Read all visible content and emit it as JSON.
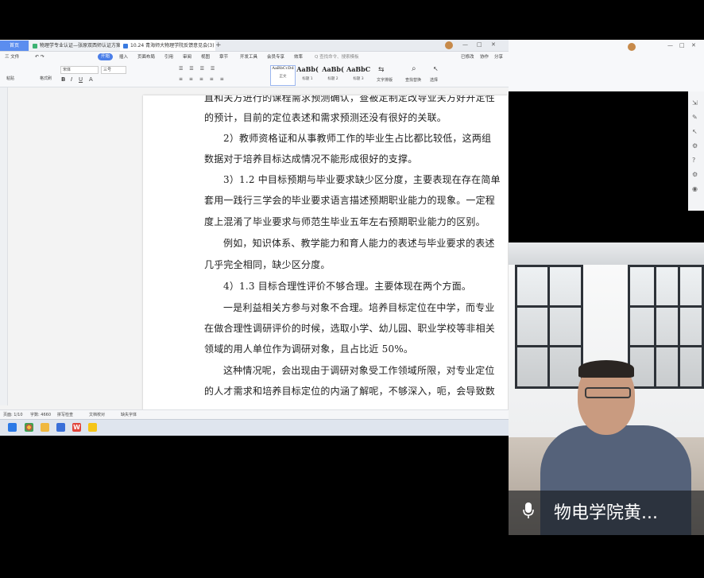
{
  "tabs": {
    "home": "首页",
    "tab1": "物理学专业认证—张原双西师认证方案",
    "tab2": "10.24 青海师大物理学院反馈意见会(3)"
  },
  "menu": {
    "file": "三 文件",
    "items": [
      "开始",
      "插入",
      "页面布局",
      "引用",
      "审阅",
      "视图",
      "章节",
      "开发工具",
      "会员专享",
      "效率"
    ],
    "search": "Q 查找命令、搜索模板",
    "right": [
      "已修改",
      "协作",
      "分享"
    ]
  },
  "ribbon": {
    "font_name": "宋体",
    "font_size": "三号",
    "paste": "粘贴",
    "format_painter": "格式刷",
    "styles": [
      {
        "sample": "AaBbCcDd",
        "label": "正文"
      },
      {
        "sample": "AaBb(",
        "label": "标题 1"
      },
      {
        "sample": "AaBb(",
        "label": "标题 2"
      },
      {
        "sample": "AaBbC",
        "label": "标题 3"
      }
    ],
    "text_layout": "文字排版",
    "find_replace": "查找替换",
    "select": "选择"
  },
  "document": {
    "lines": [
      "直和关方进行的课程需求预测确认，查被定制定改导业关方好开定性",
      "的预计，目前的定位表述和需求预测还没有很好的关联。",
      "2）教师资格证和从事教师工作的毕业生占比都比较低，这两组",
      "数据对于培养目标达成情况不能形成很好的支撑。",
      "3）1.2 中目标预期与毕业要求缺少区分度，主要表现在存在简单",
      "套用一践行三学会的毕业要求语言描述预期职业能力的现象。一定程",
      "度上混淆了毕业要求与师范生毕业五年左右预期职业能力的区别。",
      "例如，知识体系、教学能力和育人能力的表述与毕业要求的表述",
      "几乎完全相同，缺少区分度。",
      "4）1.3 目标合理性评价不够合理。主要体现在两个方面。",
      "一是利益相关方参与对象不合理。培养目标定位在中学，而专业",
      "在做合理性调研评价的时候，选取小学、幼儿园、职业学校等非相关",
      "领域的用人单位作为调研对象，且占比近 50%。",
      "这种情况呢，会出现由于调研对象受工作领域所限，对专业定位",
      "的人才需求和培养目标定位的内涵了解呢，不够深入，呃，会导致数"
    ]
  },
  "status": {
    "page": "页面: 1/10",
    "words": "字数: 4660",
    "spell": "拼写检查",
    "proof": "文档校对",
    "missing_font": "缺失字体"
  },
  "video": {
    "name": "物电学院黄..."
  },
  "colors": {
    "accent": "#4a7ee8",
    "wps_red": "#e2443a"
  }
}
